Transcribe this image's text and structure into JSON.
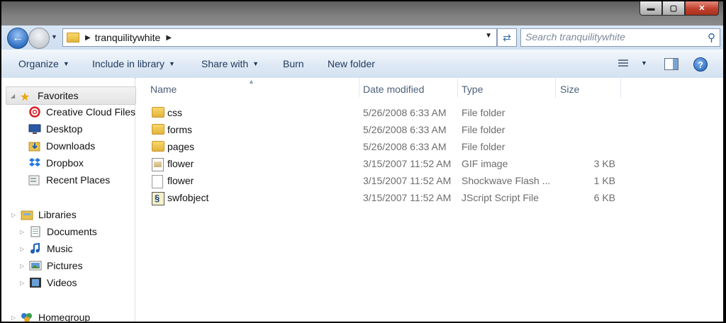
{
  "window": {
    "controls": {
      "minimize": "▬",
      "maximize": "▢",
      "close": "✕"
    }
  },
  "address": {
    "path": [
      "tranquilitywhite"
    ],
    "search_placeholder": "Search tranquilitywhite"
  },
  "toolbar": {
    "organize": "Organize",
    "include_in_library": "Include in library",
    "share_with": "Share with",
    "burn": "Burn",
    "new_folder": "New folder"
  },
  "nav": {
    "favorites": {
      "label": "Favorites",
      "items": [
        "Creative Cloud Files",
        "Desktop",
        "Downloads",
        "Dropbox",
        "Recent Places"
      ]
    },
    "libraries": {
      "label": "Libraries",
      "items": [
        "Documents",
        "Music",
        "Pictures",
        "Videos"
      ]
    },
    "homegroup": {
      "label": "Homegroup"
    }
  },
  "columns": {
    "name": "Name",
    "date_modified": "Date modified",
    "type": "Type",
    "size": "Size"
  },
  "files": [
    {
      "name": "css",
      "date": "5/26/2008 6:33 AM",
      "type": "File folder",
      "size": "",
      "icon": "folder-icon"
    },
    {
      "name": "forms",
      "date": "5/26/2008 6:33 AM",
      "type": "File folder",
      "size": "",
      "icon": "folder-icon"
    },
    {
      "name": "pages",
      "date": "5/26/2008 6:33 AM",
      "type": "File folder",
      "size": "",
      "icon": "folder-icon"
    },
    {
      "name": "flower",
      "date": "3/15/2007 11:52 AM",
      "type": "GIF image",
      "size": "3 KB",
      "icon": "gif-file-icon"
    },
    {
      "name": "flower",
      "date": "3/15/2007 11:52 AM",
      "type": "Shockwave Flash ...",
      "size": "1 KB",
      "icon": "swf-file-icon"
    },
    {
      "name": "swfobject",
      "date": "3/15/2007 11:52 AM",
      "type": "JScript Script File",
      "size": "6 KB",
      "icon": "js-file-icon"
    }
  ]
}
